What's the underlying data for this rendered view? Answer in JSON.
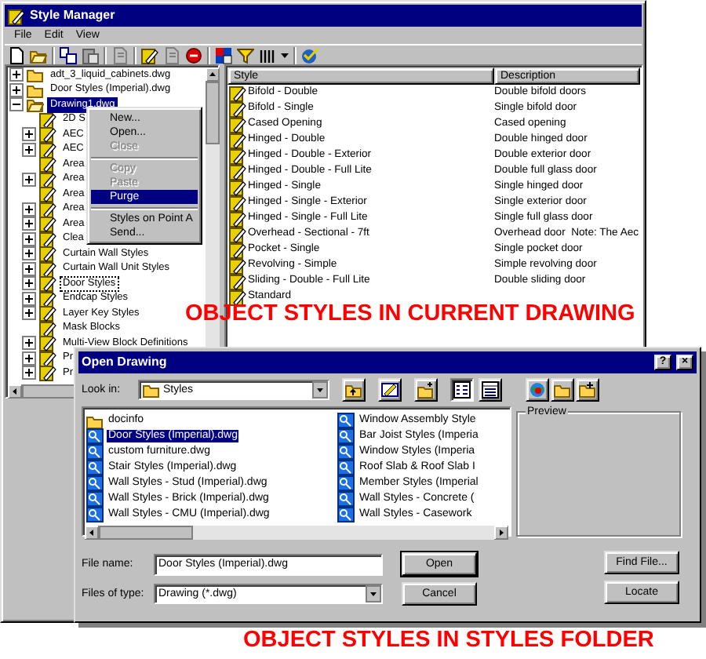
{
  "style_manager": {
    "title": "Style Manager",
    "menu": [
      "File",
      "Edit",
      "View"
    ],
    "tree": [
      {
        "label": "adt_3_liquid_cabinets.dwg",
        "expandable": true,
        "expanded": false,
        "selected": false,
        "focused": false
      },
      {
        "label": "Door Styles (Imperial).dwg",
        "expandable": true,
        "expanded": false,
        "selected": false,
        "focused": false
      },
      {
        "label": "Drawing1.dwg",
        "expandable": true,
        "expanded": true,
        "selected": true,
        "focused": false,
        "children": [
          {
            "label": "2D S",
            "expandable": false,
            "selected": false,
            "focused": false
          },
          {
            "label": "AEC",
            "expandable": true,
            "selected": false,
            "focused": false
          },
          {
            "label": "AEC",
            "expandable": true,
            "selected": false,
            "focused": false
          },
          {
            "label": "Area",
            "expandable": false,
            "selected": false,
            "focused": false
          },
          {
            "label": "Area",
            "expandable": true,
            "selected": false,
            "focused": false
          },
          {
            "label": "Area",
            "expandable": false,
            "selected": false,
            "focused": false
          },
          {
            "label": "Area",
            "expandable": true,
            "selected": false,
            "focused": false
          },
          {
            "label": "Area",
            "expandable": true,
            "selected": false,
            "focused": false
          },
          {
            "label": "Clea",
            "expandable": true,
            "selected": false,
            "focused": false
          },
          {
            "label": "Curtain Wall Styles",
            "expandable": true,
            "selected": false,
            "focused": false
          },
          {
            "label": "Curtain Wall Unit Styles",
            "expandable": true,
            "selected": false,
            "focused": false
          },
          {
            "label": "Door Styles",
            "expandable": true,
            "selected": false,
            "focused": true
          },
          {
            "label": "Endcap Styles",
            "expandable": true,
            "selected": false,
            "focused": false
          },
          {
            "label": "Layer Key Styles",
            "expandable": true,
            "selected": false,
            "focused": false
          },
          {
            "label": "Mask Blocks",
            "expandable": false,
            "selected": false,
            "focused": false
          },
          {
            "label": "Multi-View Block Definitions",
            "expandable": true,
            "selected": false,
            "focused": false
          },
          {
            "label": "Pr",
            "expandable": true,
            "selected": false,
            "focused": false
          },
          {
            "label": "Pr",
            "expandable": true,
            "selected": false,
            "focused": false
          }
        ]
      }
    ],
    "style_list": {
      "columns": [
        "Style",
        "Description"
      ],
      "rows": [
        {
          "style": "Bifold - Double",
          "description": "Double bifold doors"
        },
        {
          "style": "Bifold - Single",
          "description": "Single bifold door"
        },
        {
          "style": "Cased Opening",
          "description": "Cased opening"
        },
        {
          "style": "Hinged - Double",
          "description": "Double hinged door"
        },
        {
          "style": "Hinged - Double - Exterior",
          "description": "Double exterior door"
        },
        {
          "style": "Hinged - Double - Full Lite",
          "description": "Double full glass door"
        },
        {
          "style": "Hinged - Single",
          "description": "Single hinged door"
        },
        {
          "style": "Hinged - Single - Exterior",
          "description": "Single exterior door"
        },
        {
          "style": "Hinged - Single - Full Lite",
          "description": "Single full glass door"
        },
        {
          "style": "Overhead - Sectional - 7ft",
          "description": "Overhead door  Note: The Aec"
        },
        {
          "style": "Pocket - Single",
          "description": "Single pocket door"
        },
        {
          "style": "Revolving - Simple",
          "description": "Simple revolving door"
        },
        {
          "style": "Sliding - Double - Full Lite",
          "description": "Double sliding door"
        },
        {
          "style": "Standard"
        }
      ]
    }
  },
  "context_menu": [
    {
      "kind": "item",
      "label": "New...",
      "disabled": false,
      "selected": false
    },
    {
      "kind": "item",
      "label": "Open...",
      "disabled": false,
      "selected": false
    },
    {
      "kind": "item",
      "label": "Close",
      "disabled": true,
      "selected": false
    },
    {
      "kind": "separator"
    },
    {
      "kind": "item",
      "label": "Copy",
      "disabled": true,
      "selected": false
    },
    {
      "kind": "item",
      "label": "Paste",
      "disabled": true,
      "selected": false
    },
    {
      "kind": "item",
      "label": "Purge",
      "disabled": false,
      "selected": true
    },
    {
      "kind": "separator"
    },
    {
      "kind": "item",
      "label": "Styles on Point A",
      "disabled": false,
      "selected": false
    },
    {
      "kind": "item",
      "label": "Send...",
      "disabled": false,
      "selected": false
    }
  ],
  "open_dialog": {
    "title": "Open Drawing",
    "title_buttons": [
      "?",
      "×"
    ],
    "look_in": {
      "label": "Look in:",
      "value": "Styles"
    },
    "view_modes": [
      {
        "kind": "list",
        "selected": true
      },
      {
        "kind": "details",
        "selected": false
      }
    ],
    "files": [
      {
        "name": "docinfo",
        "kind": "folder",
        "selected": false
      },
      {
        "name": "Door Styles (Imperial).dwg",
        "kind": "drawing",
        "selected": true
      },
      {
        "name": "custom furniture.dwg",
        "kind": "drawing",
        "selected": false
      },
      {
        "name": "Stair Styles (Imperial).dwg",
        "kind": "drawing",
        "selected": false
      },
      {
        "name": "Wall Styles - Stud (Imperial).dwg",
        "kind": "drawing",
        "selected": false
      },
      {
        "name": "Wall Styles - Brick (Imperial).dwg",
        "kind": "drawing",
        "selected": false
      },
      {
        "name": "Wall Styles - CMU (Imperial).dwg",
        "kind": "drawing",
        "selected": false
      },
      {
        "name": "Window Assembly Style",
        "kind": "drawing",
        "selected": false
      },
      {
        "name": "Bar Joist Styles (Imperia",
        "kind": "drawing",
        "selected": false
      },
      {
        "name": "Window Styles (Imperia",
        "kind": "drawing",
        "selected": false
      },
      {
        "name": "Roof Slab & Roof Slab I",
        "kind": "drawing",
        "selected": false
      },
      {
        "name": "Member Styles (Imperial",
        "kind": "drawing",
        "selected": false
      },
      {
        "name": "Wall Styles - Concrete (",
        "kind": "drawing",
        "selected": false
      },
      {
        "name": "Wall Styles - Casework",
        "kind": "drawing",
        "selected": false
      }
    ],
    "preview_label": "Preview",
    "file_name": {
      "label": "File name:",
      "value": "Door Styles (Imperial).dwg"
    },
    "file_type": {
      "label": "Files of type:",
      "value": "Drawing (*.dwg)"
    },
    "buttons": [
      "Open",
      "Cancel"
    ],
    "side_buttons": [
      "Find File...",
      "Locate"
    ]
  },
  "annotations": [
    "OBJECT STYLES IN CURRENT DRAWING",
    "OBJECT STYLES IN STYLES FOLDER"
  ]
}
